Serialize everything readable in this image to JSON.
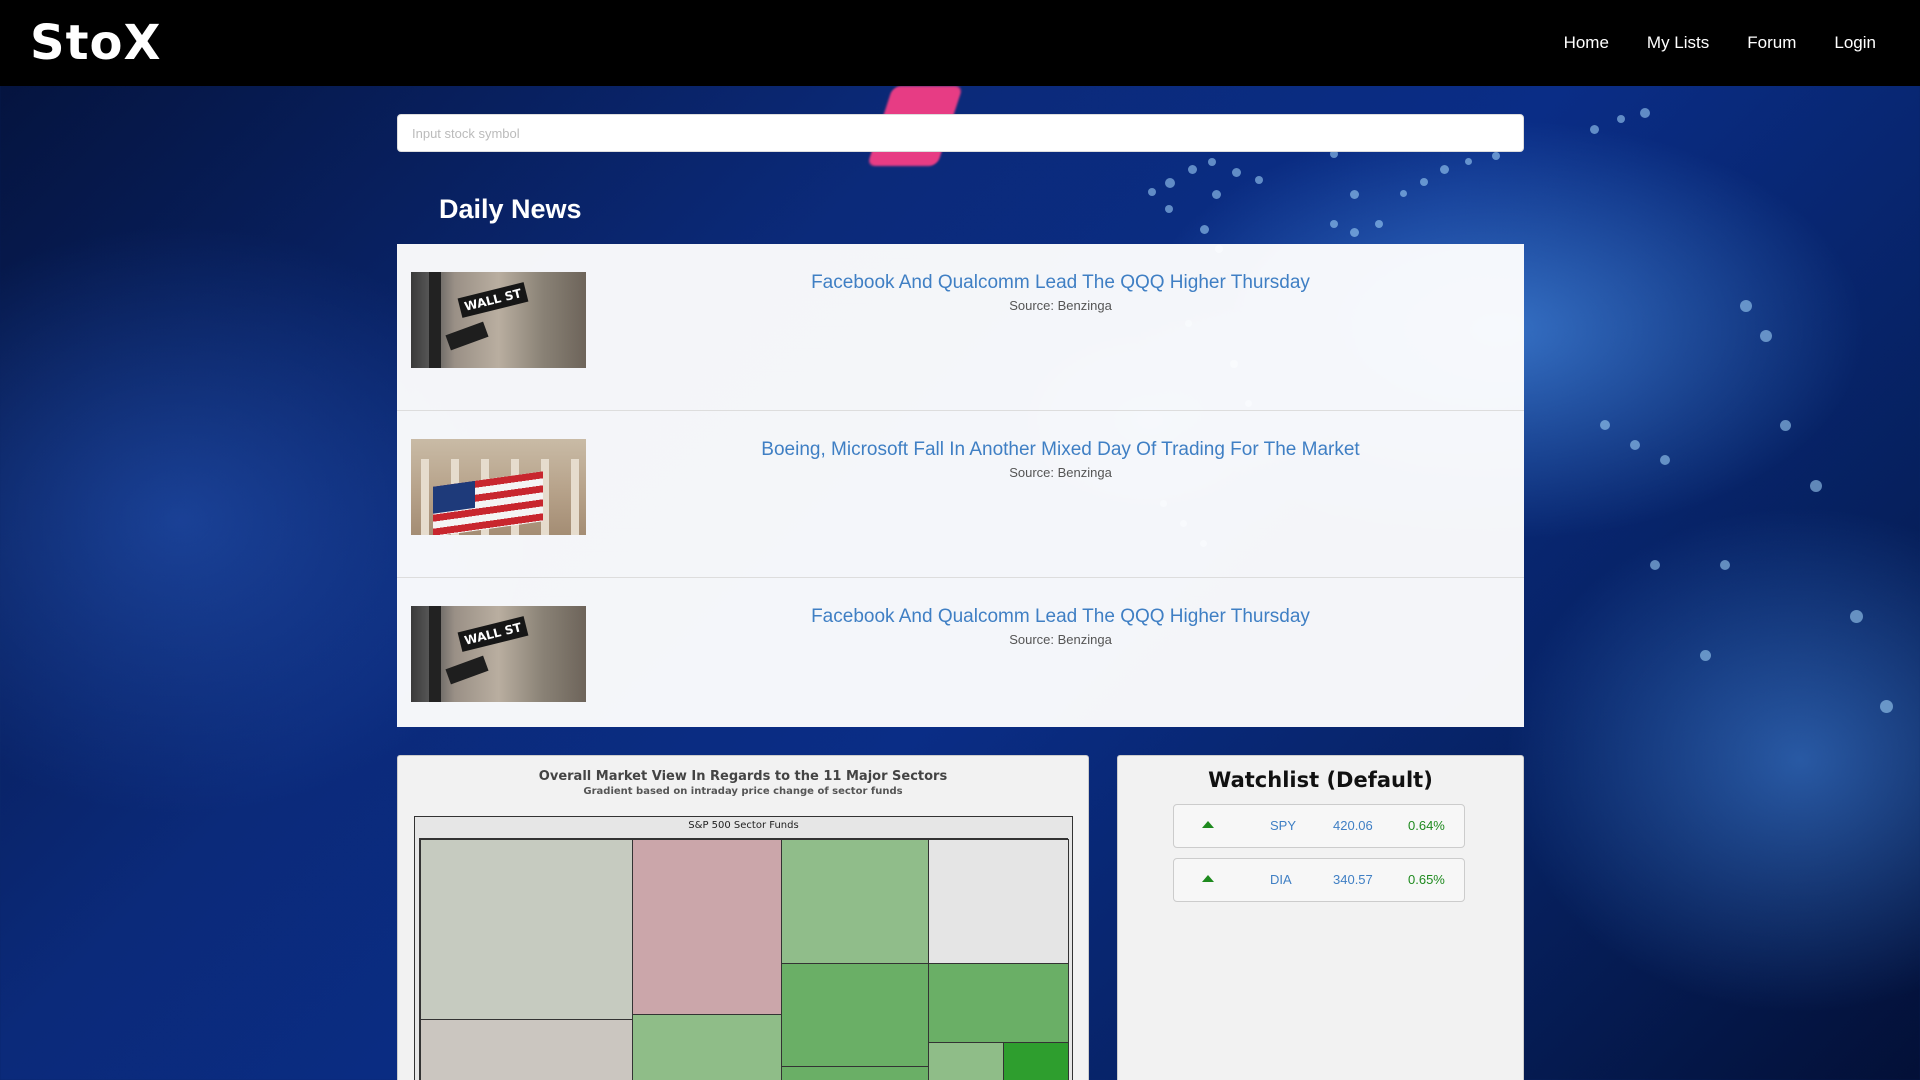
{
  "brand": {
    "logo_text": "StoX"
  },
  "nav": {
    "links": [
      {
        "label": "Home"
      },
      {
        "label": "My Lists"
      },
      {
        "label": "Forum"
      },
      {
        "label": "Login"
      }
    ]
  },
  "search": {
    "placeholder": "Input stock symbol",
    "value": ""
  },
  "news": {
    "heading": "Daily News",
    "items": [
      {
        "title": "Facebook And Qualcomm Lead The QQQ Higher Thursday",
        "source": "Source: Benzinga",
        "thumbnail": "wall-street-sign-photo",
        "thumb_text": "WALL ST"
      },
      {
        "title": "Boeing, Microsoft Fall In Another Mixed Day Of Trading For The Market",
        "source": "Source: Benzinga",
        "thumbnail": "nyse-building-flag-photo"
      },
      {
        "title": "Facebook And Qualcomm Lead The QQQ Higher Thursday",
        "source": "Source: Benzinga",
        "thumbnail": "wall-street-sign-photo",
        "thumb_text": "WALL ST"
      }
    ]
  },
  "market_view": {
    "title": "Overall Market View In Regards to the 11 Major Sectors",
    "subtitle": "Gradient based on intraday price change of sector funds",
    "treemap_label": "S&P 500 Sector Funds",
    "tile_colors": [
      "#c6cbc0",
      "#cba6aa",
      "#90bd8a",
      "#e5e5e5",
      "#cbc6c0",
      "#8fbd88",
      "#6aaf66",
      "#6aaf66",
      "#8fbd88",
      "#2e9e2e",
      "#6aaf66"
    ]
  },
  "watchlist": {
    "title": "Watchlist (Default)",
    "rows": [
      {
        "direction": "up-arrow-icon",
        "symbol": "SPY",
        "price": "420.06",
        "change": "0.64%"
      },
      {
        "direction": "up-arrow-icon",
        "symbol": "DIA",
        "price": "340.57",
        "change": "0.65%"
      }
    ],
    "up_color": "#1e8a1e",
    "link_color": "#3f7fc4"
  }
}
